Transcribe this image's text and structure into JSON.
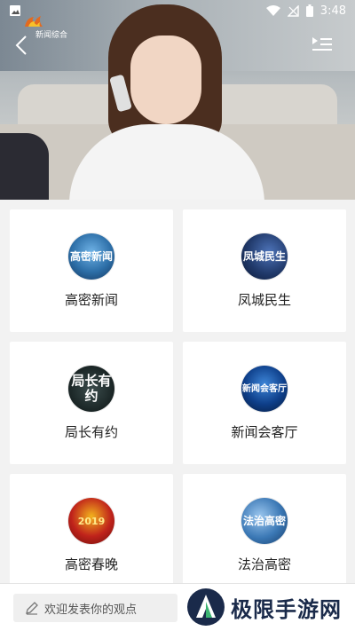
{
  "status_bar": {
    "time": "3:48",
    "icons": [
      "image-icon",
      "wifi-icon",
      "signal-icon",
      "battery-icon"
    ]
  },
  "player": {
    "channel_name": "新闻综合",
    "icons": [
      "back-icon",
      "playlist-icon"
    ]
  },
  "programs": [
    {
      "title": "高密新闻",
      "logo_text": "高密新闻",
      "logo_color": "#2d6fa8"
    },
    {
      "title": "凤城民生",
      "logo_text": "凤城民生",
      "logo_color": "#213a6b"
    },
    {
      "title": "局长有约",
      "logo_text": "局长有约",
      "logo_color": "#1e2a2a"
    },
    {
      "title": "新闻会客厅",
      "logo_text": "新闻会客厅",
      "logo_color": "#0e3f8a"
    },
    {
      "title": "高密春晚",
      "logo_text": "2019",
      "logo_color": "#c0231b"
    },
    {
      "title": "法治高密",
      "logo_text": "法治高密",
      "logo_color": "#3b78b5"
    }
  ],
  "bottom": {
    "comment_placeholder": "欢迎发表你的观点",
    "watermark_text": "极限手游网"
  },
  "colors": {
    "accent": "#1a2a4a",
    "page_bg": "#f2f2f2"
  }
}
